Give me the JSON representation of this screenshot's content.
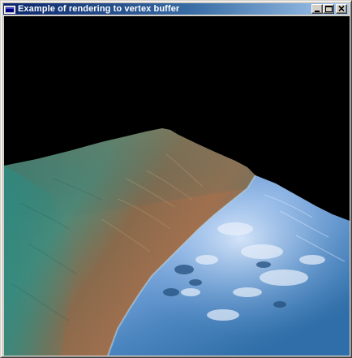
{
  "window": {
    "title": "Example of rendering to vertex buffer"
  },
  "titlebar": {
    "icons": {
      "app": "application-icon",
      "minimize": "minimize-icon",
      "maximize": "maximize-icon",
      "close": "close-icon"
    }
  },
  "viewport": {
    "scene": "3d-terrain-with-water",
    "colors": {
      "background": "#000000",
      "land_light": "#7a7a5a",
      "land_teal": "#3f8f88",
      "land_brown": "#9a6a48",
      "water_light": "#9ec3ea",
      "water_deep": "#3f7fbf"
    }
  }
}
